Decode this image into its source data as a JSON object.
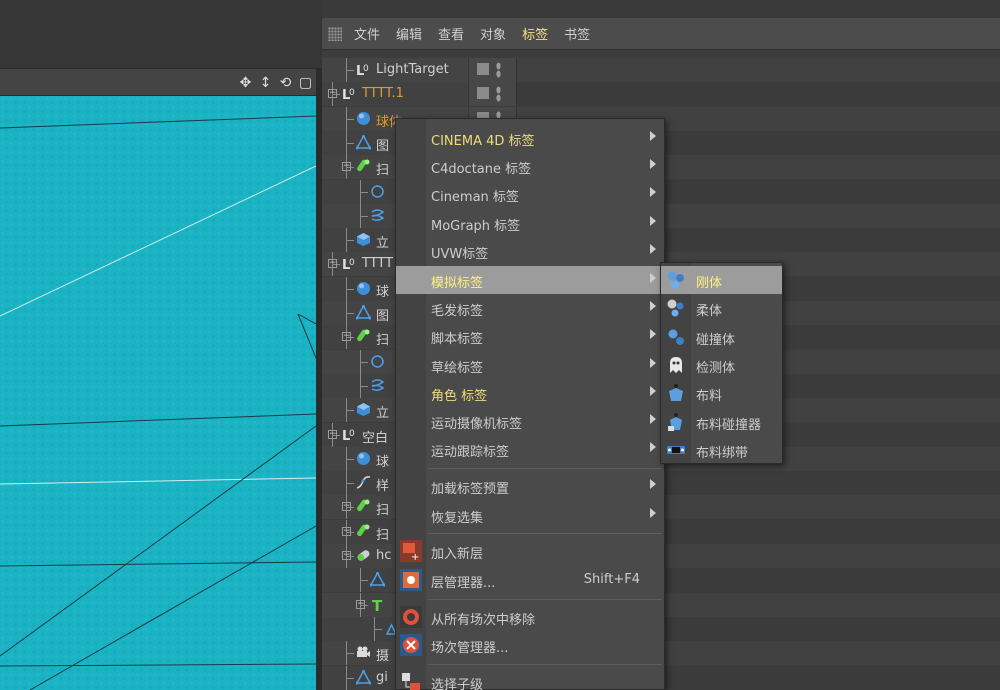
{
  "menubar": {
    "items": [
      {
        "label": "文件",
        "active": false
      },
      {
        "label": "编辑",
        "active": false
      },
      {
        "label": "查看",
        "active": false
      },
      {
        "label": "对象",
        "active": false
      },
      {
        "label": "标签",
        "active": true
      },
      {
        "label": "书签",
        "active": false
      }
    ]
  },
  "objects": [
    {
      "label": "LightTarget",
      "icon": "null-icon",
      "color": "normal"
    },
    {
      "label": "TTTT.1",
      "icon": "null-icon",
      "color": "orange"
    },
    {
      "label": "球体",
      "icon": "sphere-icon",
      "color": "orange"
    },
    {
      "label": "图",
      "icon": "polygon-icon",
      "color": "normal"
    },
    {
      "label": "扫",
      "icon": "sweep-icon",
      "color": "normal"
    },
    {
      "label": "",
      "icon": "circle-spline-icon",
      "color": "normal"
    },
    {
      "label": "",
      "icon": "helix-spline-icon",
      "color": "normal"
    },
    {
      "label": "立",
      "icon": "cube-icon",
      "color": "normal"
    },
    {
      "label": "TTTT",
      "icon": "null-icon",
      "color": "normal"
    },
    {
      "label": "球",
      "icon": "sphere-icon",
      "color": "normal"
    },
    {
      "label": "图",
      "icon": "polygon-icon",
      "color": "normal"
    },
    {
      "label": "扫",
      "icon": "sweep-icon",
      "color": "normal"
    },
    {
      "label": "",
      "icon": "circle-spline-icon",
      "color": "normal"
    },
    {
      "label": "",
      "icon": "helix-spline-icon",
      "color": "normal"
    },
    {
      "label": "立",
      "icon": "cube-icon",
      "color": "normal"
    },
    {
      "label": "空白",
      "icon": "null-icon",
      "color": "normal"
    },
    {
      "label": "球",
      "icon": "sphere-icon",
      "color": "normal"
    },
    {
      "label": "样",
      "icon": "spline-icon",
      "color": "normal"
    },
    {
      "label": "扫",
      "icon": "sweep-icon",
      "color": "normal"
    },
    {
      "label": "扫",
      "icon": "sweep-icon",
      "color": "normal"
    },
    {
      "label": "hc",
      "icon": "capsule-icon",
      "color": "normal"
    },
    {
      "label": "",
      "icon": "polygon-icon",
      "color": "normal"
    },
    {
      "label": "",
      "icon": "text-icon",
      "color": "normal"
    },
    {
      "label": "",
      "icon": "small-polygon-icon",
      "color": "normal"
    },
    {
      "label": "摄",
      "icon": "camera-icon",
      "color": "normal"
    },
    {
      "label": "gi",
      "icon": "polygon-icon",
      "color": "normal"
    }
  ],
  "context_menu": {
    "items": [
      {
        "label": "CINEMA 4D 标签",
        "submenu": true,
        "yellow": true
      },
      {
        "label": "C4doctane 标签",
        "submenu": true
      },
      {
        "label": "Cineman 标签",
        "submenu": true
      },
      {
        "label": "MoGraph 标签",
        "submenu": true
      },
      {
        "label": "UVW标签",
        "submenu": true
      },
      {
        "label": "模拟标签",
        "submenu": true,
        "highlighted": true
      },
      {
        "label": "毛发标签",
        "submenu": true
      },
      {
        "label": "脚本标签",
        "submenu": true
      },
      {
        "label": "草绘标签",
        "submenu": true
      },
      {
        "label": "角色 标签",
        "submenu": true,
        "yellow": true
      },
      {
        "label": "运动摄像机标签",
        "submenu": true
      },
      {
        "label": "运动跟踪标签",
        "submenu": true
      },
      {
        "label": "加载标签预置",
        "submenu": true
      },
      {
        "label": "恢复选集",
        "submenu": true
      },
      {
        "label": "加入新层",
        "icon": "add-layer-icon"
      },
      {
        "label": "层管理器...",
        "icon": "layer-manager-icon",
        "shortcut": "Shift+F4"
      },
      {
        "label": "从所有场次中移除",
        "icon": "remove-takes-icon"
      },
      {
        "label": "场次管理器...",
        "icon": "take-manager-icon"
      },
      {
        "label": "选择子级",
        "icon": "select-children-icon"
      }
    ]
  },
  "sub_menu": {
    "items": [
      {
        "label": "刚体",
        "icon": "rigid-body-icon",
        "highlighted": true
      },
      {
        "label": "柔体",
        "icon": "soft-body-icon"
      },
      {
        "label": "碰撞体",
        "icon": "collider-icon"
      },
      {
        "label": "检测体",
        "icon": "ghost-icon"
      },
      {
        "label": "布料",
        "icon": "cloth-icon"
      },
      {
        "label": "布料碰撞器",
        "icon": "cloth-collider-icon"
      },
      {
        "label": "布料绑带",
        "icon": "cloth-belt-icon"
      }
    ]
  },
  "colors": {
    "viewport": "#19b3c4",
    "accent_yellow": "#f0dc7a",
    "orange_label": "#e19a2a",
    "highlight": "#9c9c9c"
  }
}
